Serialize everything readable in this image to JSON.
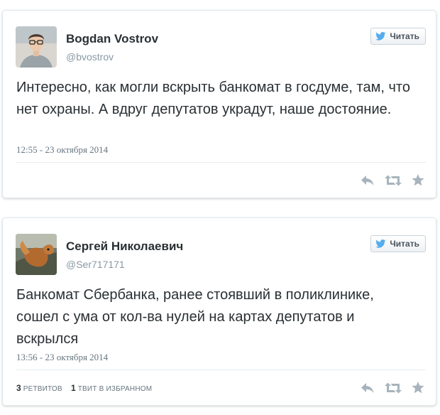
{
  "colors": {
    "icon": "#a7b4bd",
    "bird": "#55acee",
    "name": "#292f33",
    "muted": "#8899a6"
  },
  "tweets": [
    {
      "name": "Bogdan Vostrov",
      "handle": "@bvostrov",
      "follow_label": "Читать",
      "text": "Интересно, как могли вскрыть банкомат в госдуме, там, что нет охраны. А вдруг депутатов украдут, наше достояние.",
      "timestamp": "12:55 - 23 октября 2014",
      "icons": [
        "reply-icon",
        "retweet-icon",
        "favorite-icon"
      ]
    },
    {
      "name": "Сергей Николаевич",
      "handle": "@Ser717171",
      "follow_label": "Читать",
      "text": "Банкомат Сбербанка, ранее стоявший в поликлинике, сошел с ума от кол-ва нулей на картах депутатов и вскрылся",
      "timestamp": "13:56 - 23 октября 2014",
      "retweets_count": "3",
      "retweets_label": "ретвитов",
      "favorites_count": "1",
      "favorites_label": "твит в избранном",
      "icons": [
        "reply-icon",
        "retweet-icon",
        "favorite-icon"
      ]
    }
  ]
}
